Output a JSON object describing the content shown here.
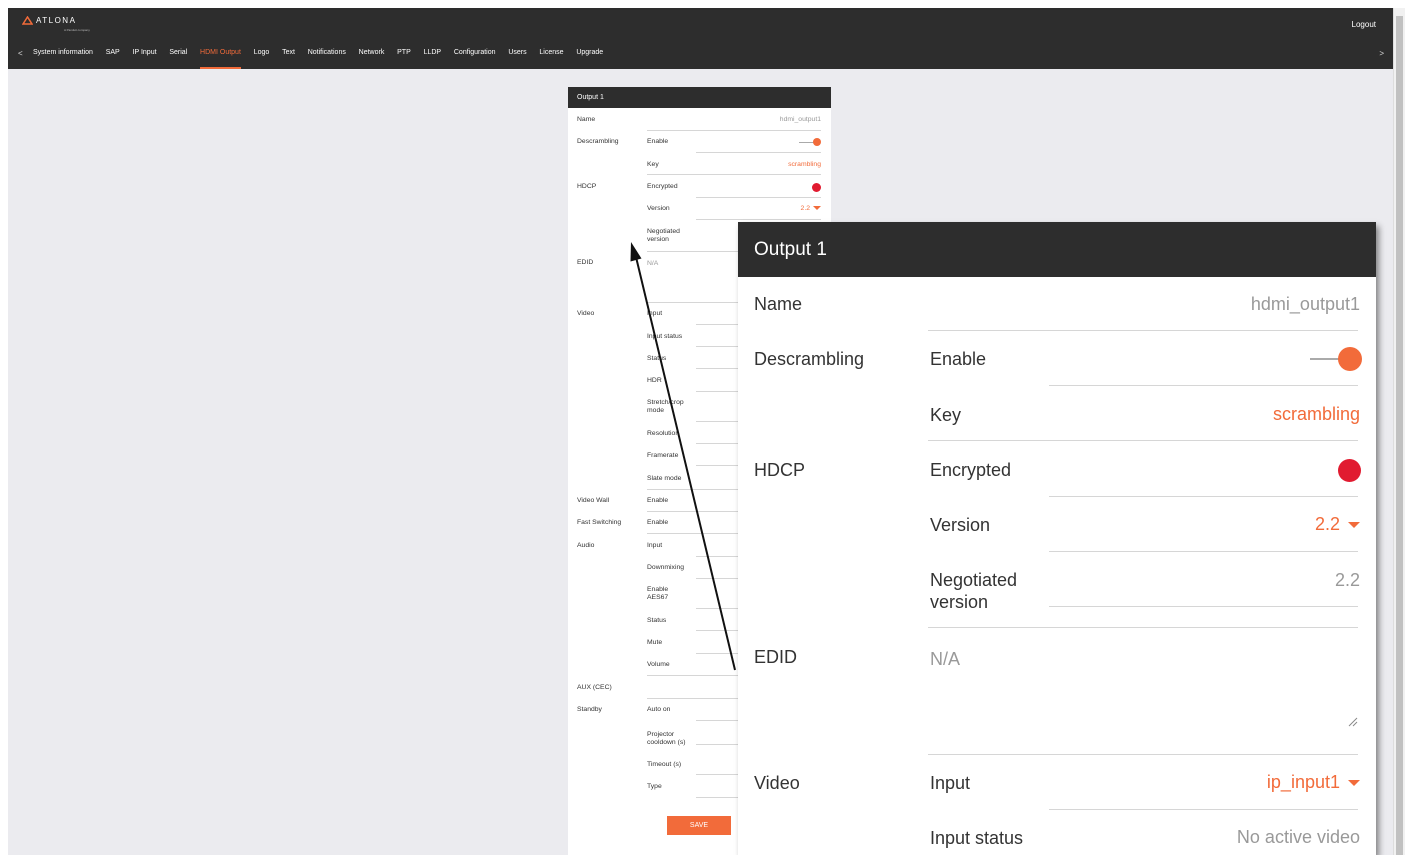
{
  "header": {
    "brand": "ATLONA",
    "brand_sub": "A Panduit company",
    "logout_label": "Logout",
    "nav_prev": "<",
    "nav_next": ">",
    "tabs": [
      {
        "label": "System information"
      },
      {
        "label": "SAP"
      },
      {
        "label": "IP Input"
      },
      {
        "label": "Serial"
      },
      {
        "label": "HDMI Output",
        "active": true
      },
      {
        "label": "Logo"
      },
      {
        "label": "Text"
      },
      {
        "label": "Notifications"
      },
      {
        "label": "Network"
      },
      {
        "label": "PTP"
      },
      {
        "label": "LLDP"
      },
      {
        "label": "Configuration"
      },
      {
        "label": "Users"
      },
      {
        "label": "License"
      },
      {
        "label": "Upgrade"
      }
    ]
  },
  "colors": {
    "accent": "#f26b3a",
    "header_bg": "#2d2d2d",
    "encrypted_dot": "#e11b30",
    "page_bg": "#ebebef"
  },
  "card": {
    "title": "Output 1",
    "name_label": "Name",
    "name_value": "hdmi_output1",
    "descrambling": {
      "group": "Descrambling",
      "enable_label": "Enable",
      "enable_on": true,
      "key_label": "Key",
      "key_value": "scrambling"
    },
    "hdcp": {
      "group": "HDCP",
      "encrypted_label": "Encrypted",
      "version_label": "Version",
      "version_value": "2.2",
      "negotiated_label_1": "Negotiated",
      "negotiated_label_2": "version",
      "negotiated_value": "2.2"
    },
    "edid": {
      "group": "EDID",
      "value": "N/A"
    },
    "video": {
      "group": "Video",
      "input_label": "Input",
      "input_value": "ip_input1",
      "input_status_label": "Input status",
      "input_status_value": "No active video",
      "status_label": "Status",
      "hdr_label": "HDR",
      "stretch_label_1": "Stretch/crop",
      "stretch_label_2": "mode",
      "resolution_label": "Resolution",
      "framerate_label": "Framerate",
      "slate_label": "Slate mode"
    },
    "video_wall": {
      "group": "Video Wall",
      "label": "Enable"
    },
    "fast_switching": {
      "group": "Fast Switching",
      "label": "Enable"
    },
    "audio": {
      "group": "Audio",
      "input_label": "Input",
      "downmixing_label": "Downmixing",
      "aes_label_1": "Enable",
      "aes_label_2": "AES67",
      "status_label": "Status",
      "mute_label": "Mute",
      "volume_label": "Volume"
    },
    "aux": {
      "group": "AUX (CEC)"
    },
    "standby": {
      "group": "Standby",
      "auto_on_label": "Auto on",
      "cooldown_label_1": "Projector",
      "cooldown_label_2": "cooldown (s)",
      "timeout_label": "Timeout (s)",
      "type_label": "Type"
    },
    "save_label": "SAVE"
  },
  "icons": {
    "toggle": "toggle-on-icon",
    "status": "red-dot-icon",
    "dropdown": "caret-down-icon",
    "resize": "resize-handle-icon",
    "callout": "pointer-arrow"
  }
}
